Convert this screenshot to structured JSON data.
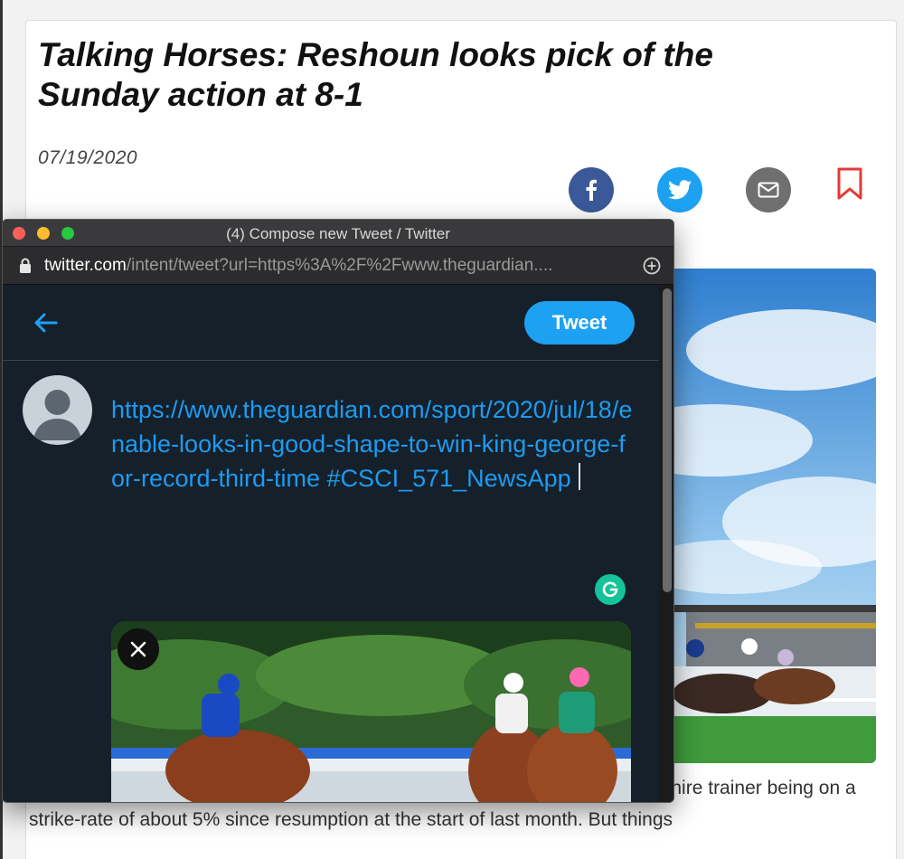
{
  "article": {
    "title": "Talking Horses: Reshoun looks pick of the Sunday action at 8-1",
    "date": "07/19/2020",
    "body": "It has not yet been a fruitful summer for Ian Williams, the shrewd Worcestershire trainer being on a strike-rate of about 5% since resumption at the start of last month. But things"
  },
  "share": {
    "facebook_icon": "facebook-icon",
    "twitter_icon": "twitter-icon",
    "email_icon": "email-icon",
    "bookmark_icon": "bookmark-icon",
    "bookmark_color": "#e53935"
  },
  "popup": {
    "window_title": "(4) Compose new Tweet / Twitter",
    "url_domain": "twitter.com",
    "url_path": "/intent/tweet?url=https%3A%2F%2Fwww.theguardian....",
    "tweet_button": "Tweet",
    "tweet_text": "https://www.theguardian.com/sport/2020/jul/18/enable-looks-in-good-shape-to-win-king-george-for-record-third-time #CSCI_571_NewsApp",
    "accent": "#1da1f2",
    "background": "#15202b"
  }
}
